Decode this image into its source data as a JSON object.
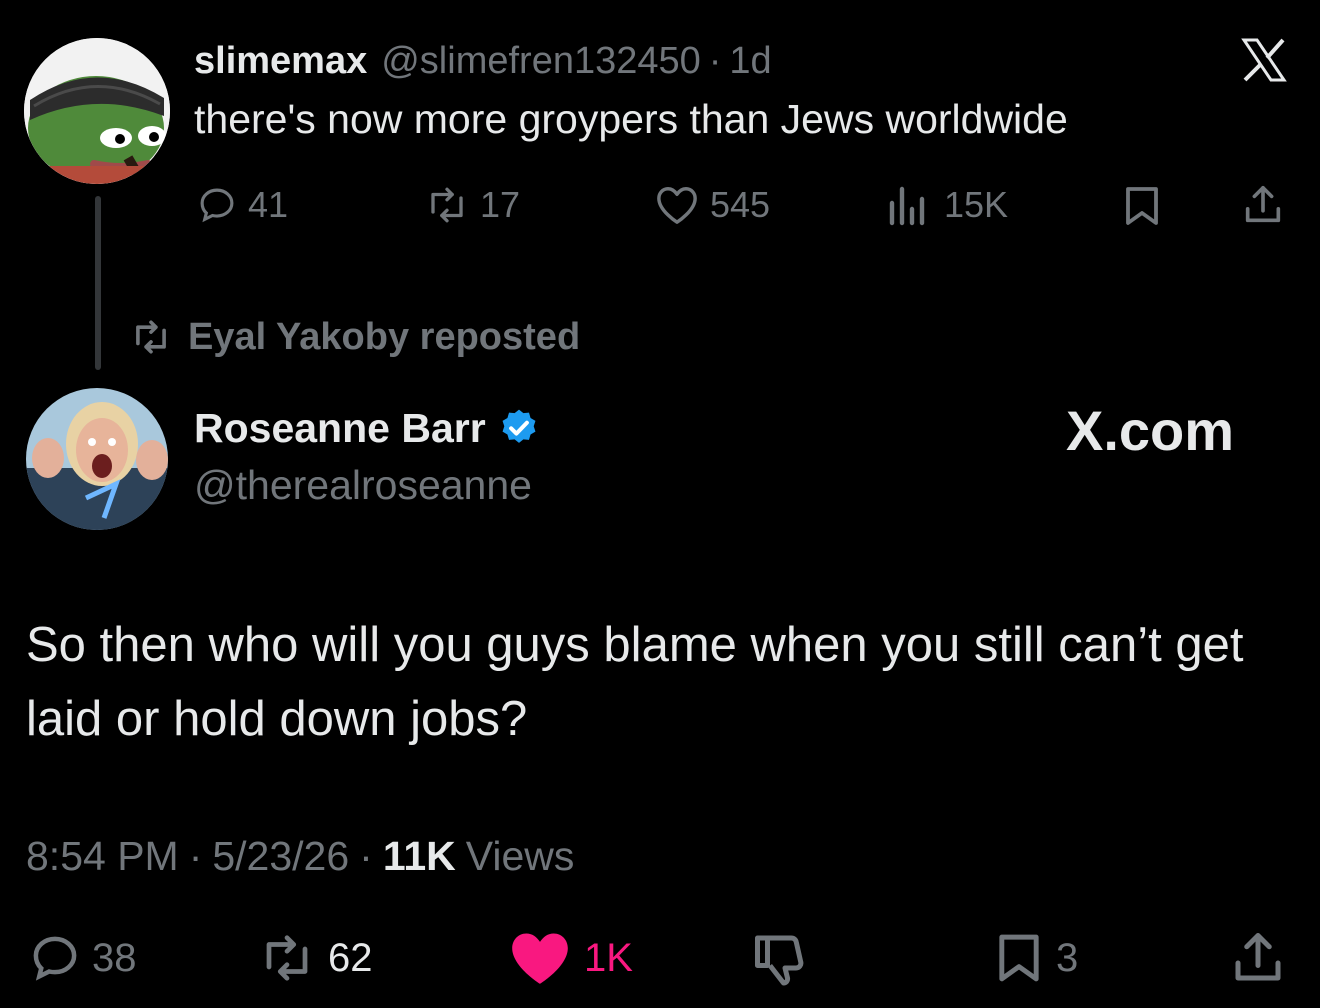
{
  "parent": {
    "name": "slimemax",
    "handle": "@slimefren132450",
    "separator": "·",
    "age": "1d",
    "text": "there's now more groypers than Jews worldwide",
    "actions": {
      "replies": "41",
      "reposts": "17",
      "likes": "545",
      "views": "15K"
    }
  },
  "repost_banner": {
    "text": "Eyal Yakoby reposted"
  },
  "main": {
    "name": "Roseanne Barr",
    "handle": "@therealroseanne",
    "brand": "X.com",
    "text": "So then who will you guys blame when you still can’t get laid or hold down jobs?",
    "meta": {
      "time": "8:54 PM",
      "sep1": "·",
      "date": "5/23/26",
      "sep2": "·",
      "views_count": "11K",
      "views_label": "Views"
    },
    "actions": {
      "replies": "38",
      "reposts": "62",
      "likes": "1K",
      "bookmarks": "3"
    }
  },
  "colors": {
    "like_active": "#f91880",
    "verified": "#1d9bf0",
    "muted": "#71767b"
  }
}
